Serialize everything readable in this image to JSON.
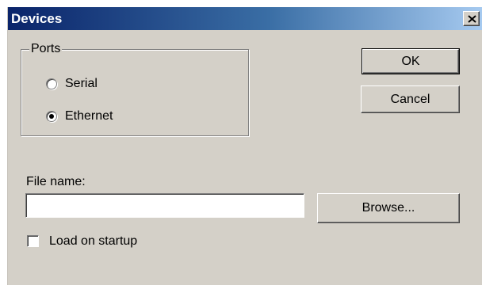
{
  "window": {
    "title": "Devices",
    "close_icon": "close-icon",
    "colors": {
      "titlebar_start": "#0a246a",
      "titlebar_end": "#a6caf0",
      "face": "#d4d0c8"
    }
  },
  "ports": {
    "group_label": "Ports",
    "options": [
      {
        "label": "Serial",
        "selected": false
      },
      {
        "label": "Ethernet",
        "selected": true
      }
    ]
  },
  "buttons": {
    "ok_label": "OK",
    "cancel_label": "Cancel",
    "browse_label": "Browse..."
  },
  "file": {
    "label": "File name:",
    "value": "",
    "placeholder": ""
  },
  "startup": {
    "label": "Load on startup",
    "checked": false
  }
}
